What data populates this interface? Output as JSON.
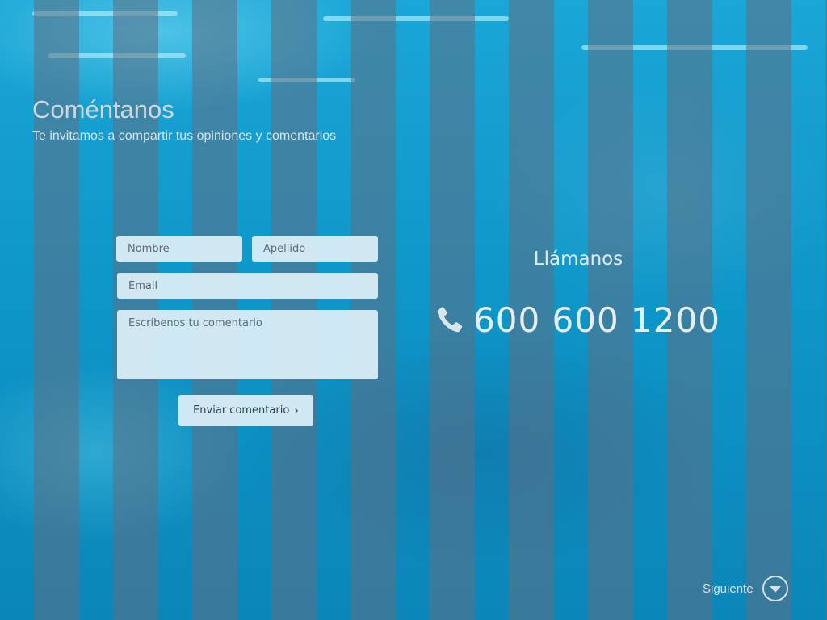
{
  "header": {
    "title": "Coméntanos",
    "subtitle": "Te invitamos a compartir tus opiniones y comentarios"
  },
  "form": {
    "nombre_placeholder": "Nombre",
    "apellido_placeholder": "Apellido",
    "email_placeholder": "Email",
    "comment_placeholder": "Escríbenos tu comentario",
    "submit_label": "Enviar comentario"
  },
  "contact": {
    "label": "Llámanos",
    "phone": "600 600 1200",
    "phone_icon": "phone-icon"
  },
  "navigation": {
    "next_label": "Siguiente",
    "next_icon": "chevron-down-circle-icon"
  },
  "colors": {
    "background": "#0a93c4",
    "field_fill": "#def0f8",
    "text_light": "#e7eef3"
  }
}
